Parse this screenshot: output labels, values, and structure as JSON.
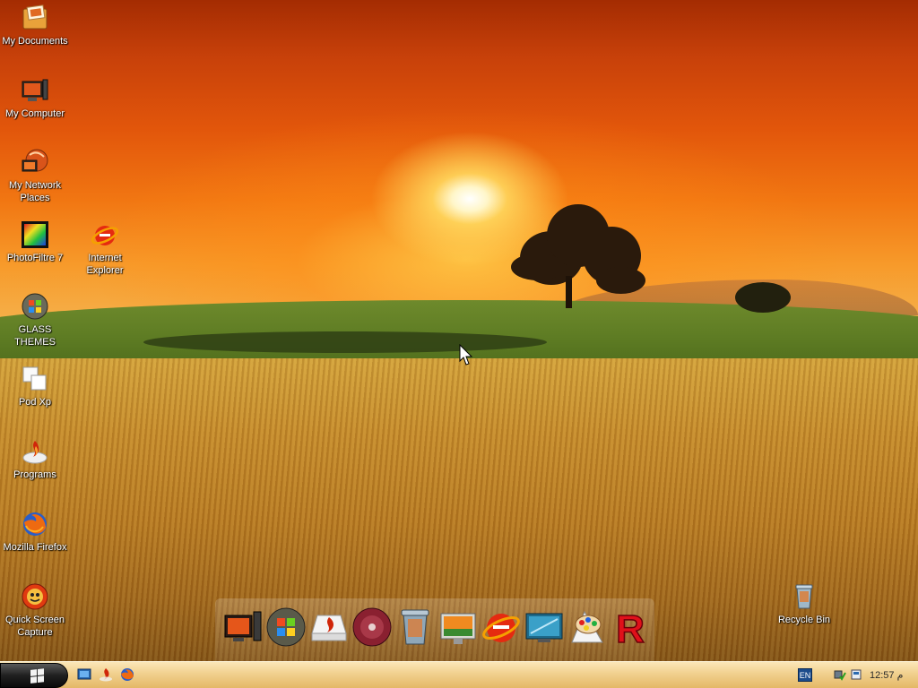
{
  "desktop": {
    "icons": [
      {
        "label": "My Documents",
        "icon": "folder-documents-icon"
      },
      {
        "label": "My Computer",
        "icon": "computer-icon"
      },
      {
        "label": "My Network Places",
        "icon": "network-places-icon"
      },
      {
        "label": "PhotoFiltre 7",
        "icon": "photofiltre-icon"
      },
      {
        "label": "Internet Explorer",
        "icon": "internet-explorer-icon"
      },
      {
        "label": "GLASS THEMES",
        "icon": "windows-orb-icon"
      },
      {
        "label": "Pod Xp",
        "icon": "pod-xp-icon"
      },
      {
        "label": "Programs",
        "icon": "programs-icon"
      },
      {
        "label": "Mozilla Firefox",
        "icon": "firefox-icon"
      },
      {
        "label": "Quick Screen Capture",
        "icon": "screen-capture-icon"
      },
      {
        "label": "Recycle Bin",
        "icon": "recycle-bin-icon"
      }
    ]
  },
  "dock": {
    "items": [
      {
        "icon": "computer-icon"
      },
      {
        "icon": "windows-orb-icon"
      },
      {
        "icon": "drive-flame-icon"
      },
      {
        "icon": "disc-icon"
      },
      {
        "icon": "trash-icon"
      },
      {
        "icon": "picture-frame-icon"
      },
      {
        "icon": "internet-explorer-icon"
      },
      {
        "icon": "monitor-icon"
      },
      {
        "icon": "paint-palette-icon"
      },
      {
        "icon": "letter-r-icon",
        "label": "R"
      }
    ]
  },
  "taskbar": {
    "quick_launch": [
      {
        "icon": "show-desktop-icon"
      },
      {
        "icon": "flame-app-icon"
      },
      {
        "icon": "firefox-icon"
      }
    ],
    "language": "EN",
    "tray": [
      {
        "icon": "network-status-icon"
      },
      {
        "icon": "safely-remove-icon"
      }
    ],
    "clock": "12:57 م"
  },
  "colors": {
    "sky_top": "#a42c02",
    "sky_mid": "#f17612",
    "field": "#c4892a",
    "taskbar": "#f1d08e",
    "start_button": "#202020"
  }
}
